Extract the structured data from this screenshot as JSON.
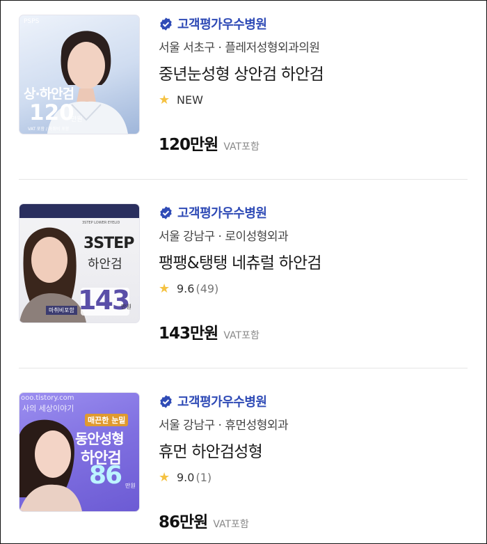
{
  "listings": [
    {
      "badge": "고객평가우수병원",
      "location": "서울 서초구 · 플레저성형외과의원",
      "title": "중년눈성형 상안검 하안검",
      "rating_label": "NEW",
      "price": "120만원",
      "vat": "VAT포함",
      "thumb": {
        "brand": "PSPS",
        "headline": "상·하안검",
        "price_num": "120",
        "unit": "만원",
        "note": "VAT 포함 / 마취비 포함"
      }
    },
    {
      "badge": "고객평가우수병원",
      "location": "서울 강남구 · 로이성형외과",
      "title": "팽팽&탱탱 네츄럴 하안검",
      "score": "9.6",
      "reviews": "(49)",
      "price": "143만원",
      "vat": "VAT포함",
      "thumb": {
        "sub": "3STEP LOWER EYELID",
        "headline1": "3STEP",
        "headline2": "하안검",
        "price_num": "143",
        "unit": "만원",
        "tag": "마취비포함"
      }
    },
    {
      "badge": "고객평가우수병원",
      "location": "서울 강남구 · 휴먼성형외과",
      "title": "휴먼 하안검성형",
      "score": "9.0",
      "reviews": "(1)",
      "price": "86만원",
      "vat": "VAT포함",
      "thumb": {
        "watermark": "ooo.tistory.com",
        "watermark2": "사의 세상이야기",
        "tag": "매끈한 눈밑",
        "headline1": "동안성형",
        "headline2": "하안검",
        "price_num": "86",
        "unit": "만원"
      }
    }
  ],
  "colors": {
    "badge": "#2f4bb6",
    "star": "#f5c242",
    "divider": "#e6e6e6"
  }
}
